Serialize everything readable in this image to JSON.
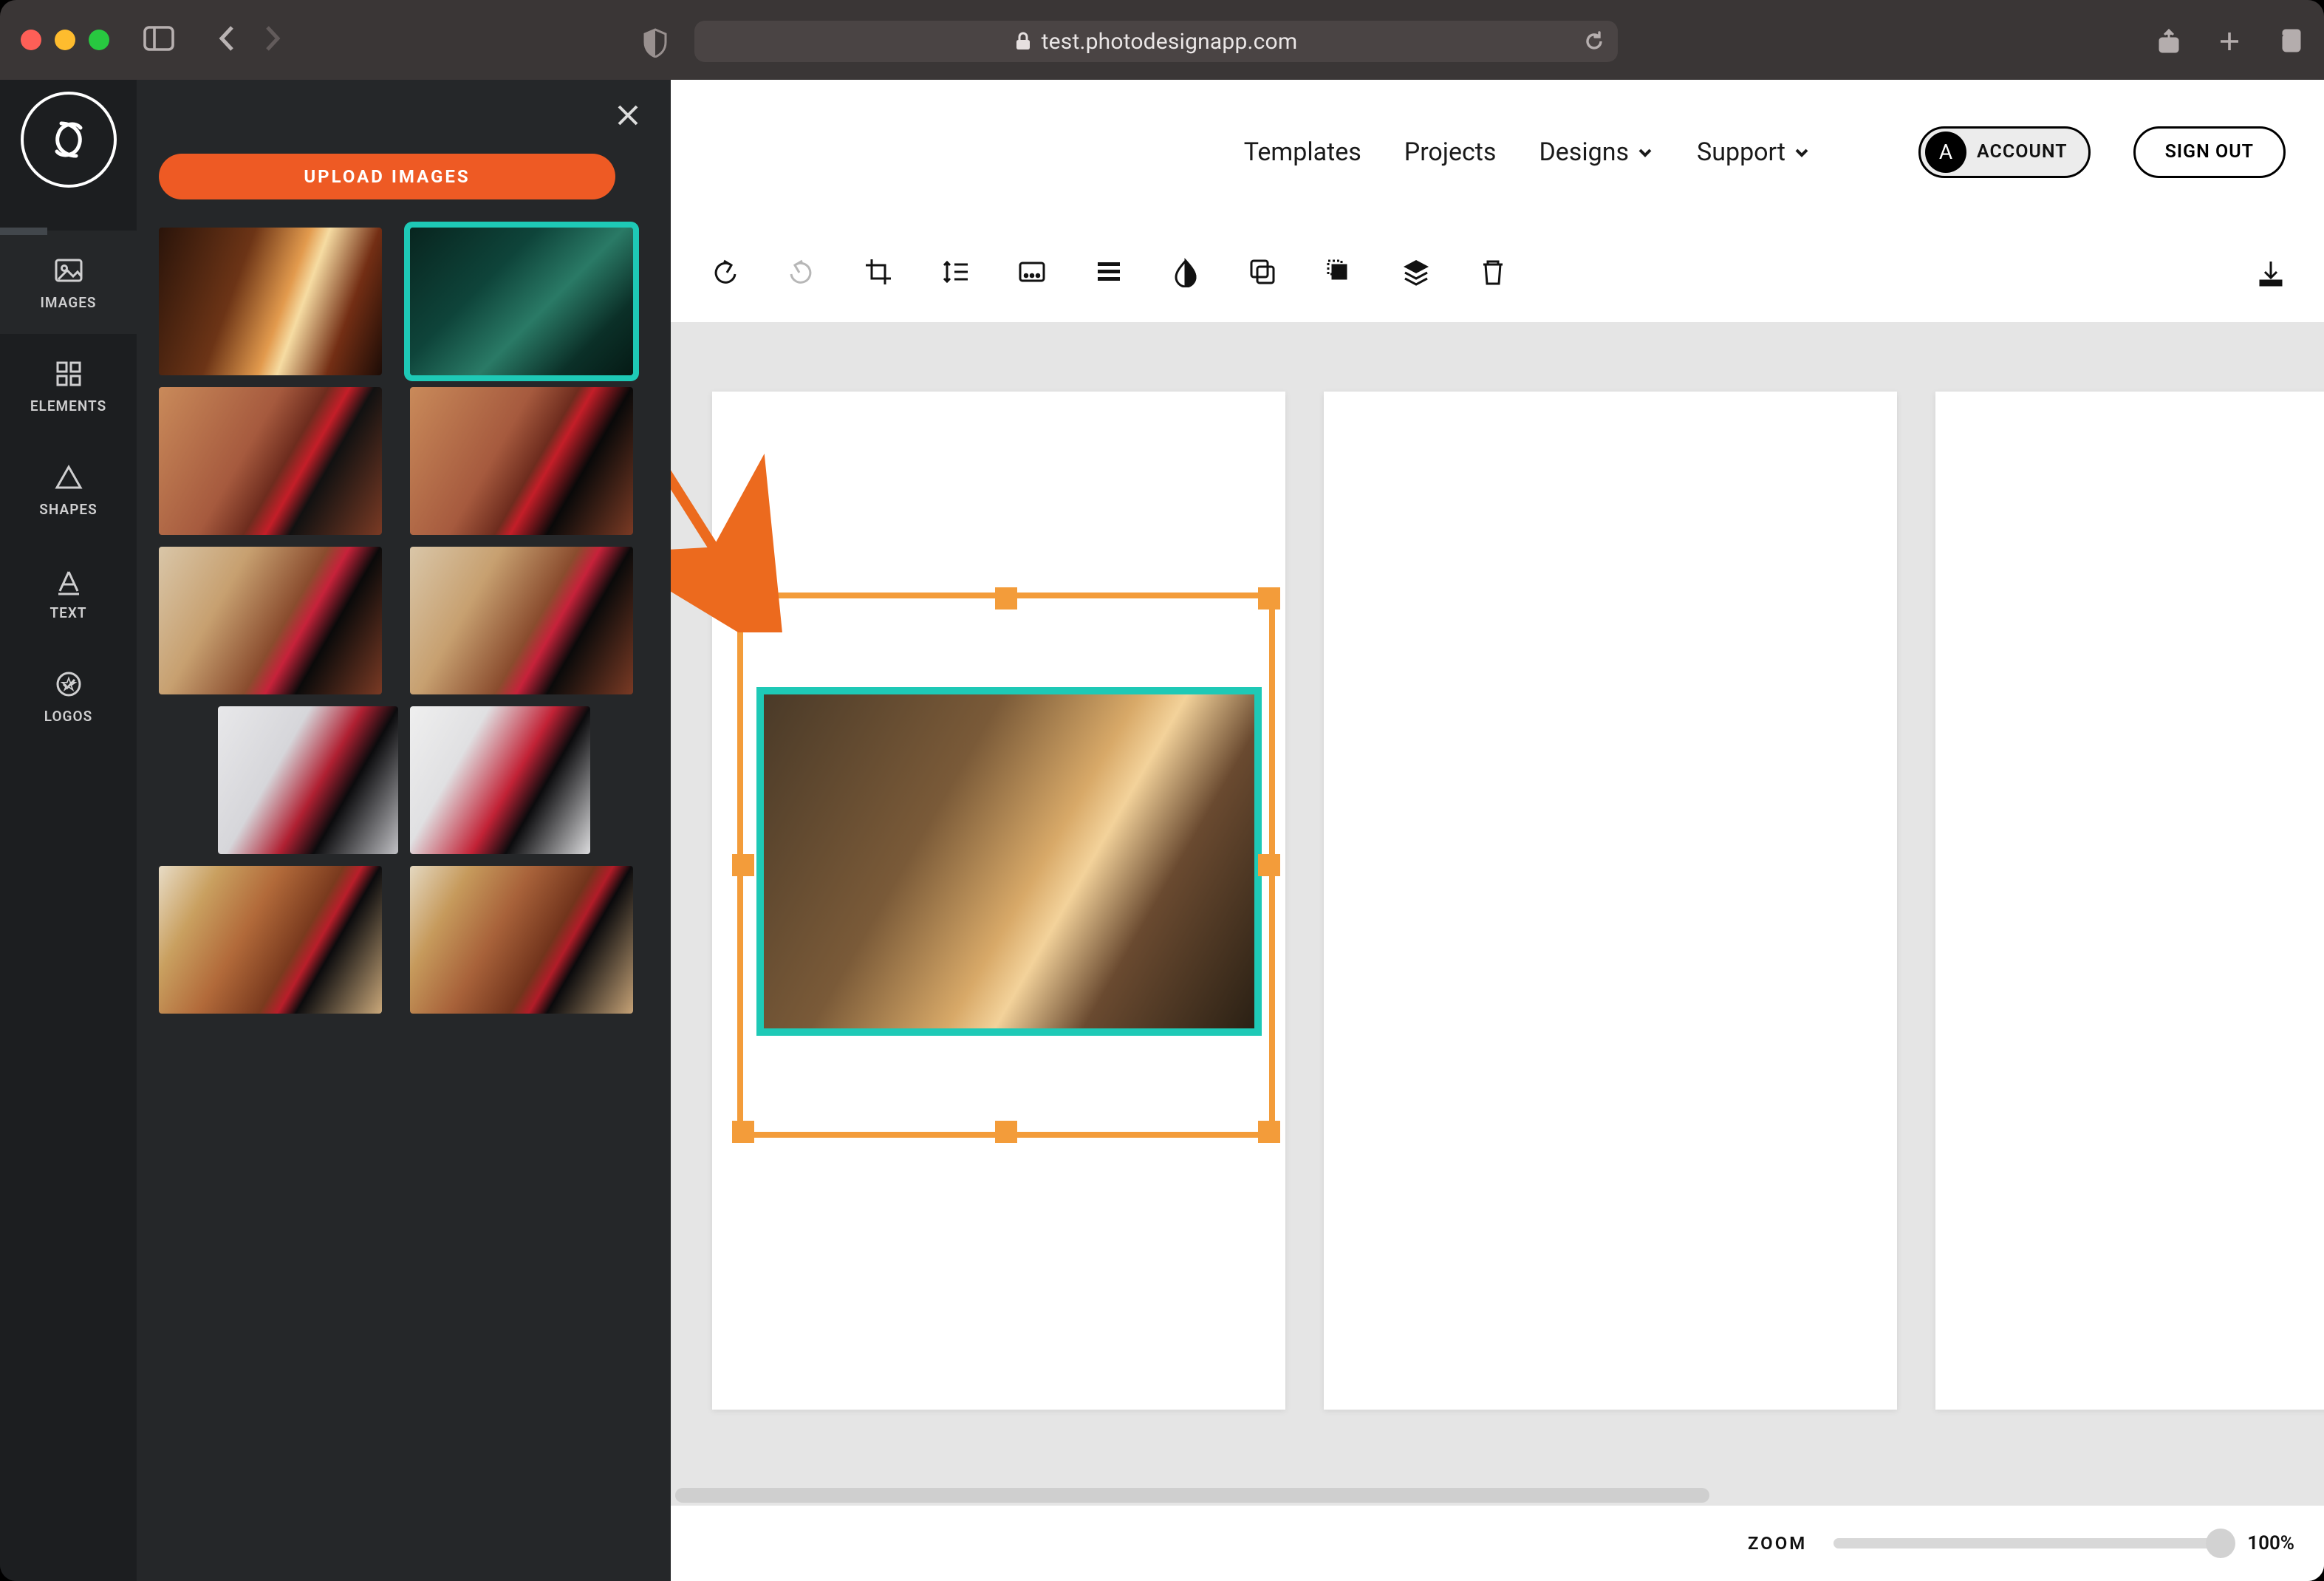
{
  "browser": {
    "url": "test.photodesignapp.com"
  },
  "rail": {
    "items": [
      {
        "label": "IMAGES"
      },
      {
        "label": "ELEMENTS"
      },
      {
        "label": "SHAPES"
      },
      {
        "label": "TEXT"
      },
      {
        "label": "LOGOS"
      }
    ],
    "active_index": 0
  },
  "panel": {
    "upload_label": "UPLOAD IMAGES",
    "selected_thumb_index": 1,
    "thumbnail_count": 10
  },
  "header": {
    "nav": [
      {
        "label": "Templates",
        "has_caret": false
      },
      {
        "label": "Projects",
        "has_caret": false
      },
      {
        "label": "Designs",
        "has_caret": true
      },
      {
        "label": "Support",
        "has_caret": true
      }
    ],
    "account_initial": "A",
    "account_label": "ACCOUNT",
    "signout_label": "SIGN OUT"
  },
  "toolbar": {
    "items": [
      "undo",
      "redo",
      "crop",
      "line-height",
      "caption",
      "align",
      "opacity",
      "copy",
      "behind",
      "layers",
      "delete"
    ],
    "redo_disabled": true
  },
  "canvas": {
    "page_count": 3,
    "selected_page": 1
  },
  "zoom": {
    "label": "ZOOM",
    "value": "100%"
  }
}
